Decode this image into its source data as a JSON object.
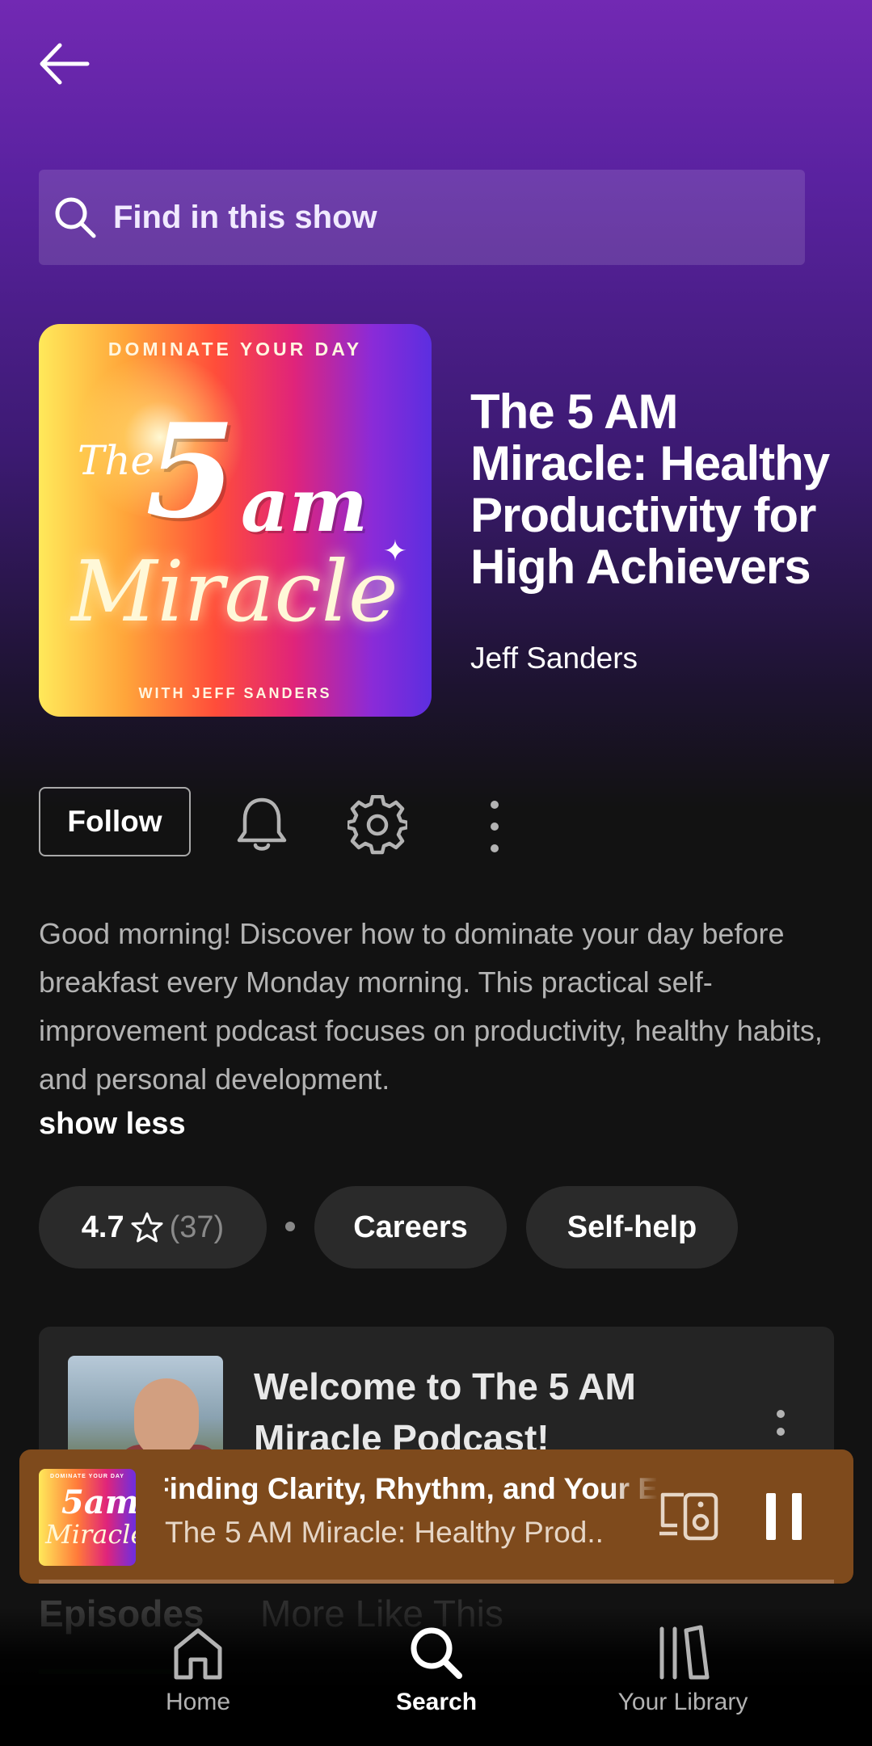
{
  "header": {
    "back_icon": "arrow-left-icon"
  },
  "search": {
    "placeholder": "Find in this show",
    "icon": "search-icon"
  },
  "show": {
    "cover": {
      "top_text": "DOMINATE YOUR DAY",
      "the": "The",
      "five": "5",
      "am": "am",
      "miracle": "Miracle",
      "bottom_text": "WITH JEFF SANDERS"
    },
    "title": "The 5 AM Miracle: Healthy Productivity for High Achievers",
    "author": "Jeff Sanders"
  },
  "actions": {
    "follow_label": "Follow",
    "bell_icon": "bell-icon",
    "settings_icon": "gear-icon",
    "more_icon": "more-vertical-icon"
  },
  "description": {
    "text": "Good morning! Discover how to dominate your day before breakfast every Monday morning. This practical self-improvement podcast focuses on productivity, healthy habits, and personal development.",
    "toggle_label": "show less"
  },
  "chips": {
    "rating": "4.7",
    "rating_count": "(37)",
    "categories": [
      "Careers",
      "Self-help"
    ]
  },
  "episode": {
    "title": "Welcome to The 5 AM Miracle Podcast!"
  },
  "player": {
    "art_top": "DOMINATE YOUR DAY",
    "art_five": "5am",
    "art_miracle": "Miracle",
    "track": "Finding Clarity, Rhythm, and Your E",
    "show": "The 5 AM Miracle: Healthy Prod..",
    "state": "playing",
    "accent": "#7e4a1c"
  },
  "tabs": [
    "Episodes",
    "More Like This"
  ],
  "nav": {
    "items": [
      {
        "label": "Home",
        "icon": "home-icon"
      },
      {
        "label": "Search",
        "icon": "search-icon",
        "active": true
      },
      {
        "label": "Your Library",
        "icon": "library-icon"
      }
    ]
  },
  "colors": {
    "background": "#121212",
    "header_gradient": "#7229b3",
    "chip": "#2a2a2a"
  }
}
